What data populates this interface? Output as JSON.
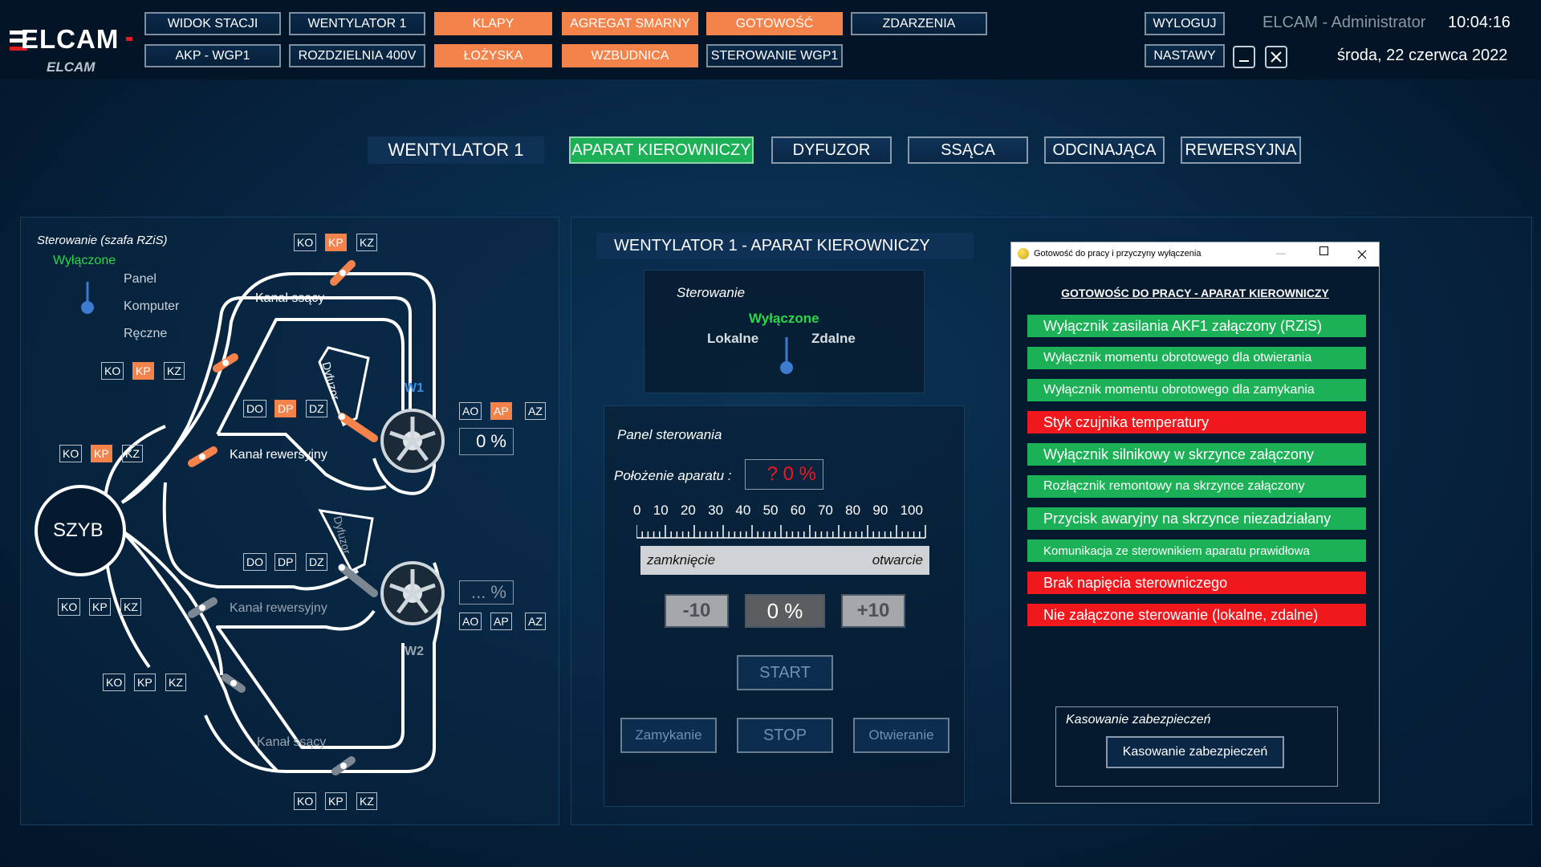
{
  "header": {
    "logo_text": "ELCAM",
    "logo_subtext": "ELCAM",
    "user": "ELCAM - Administrator",
    "time": "10:04:16",
    "date": "środa, 22 czerwca 2022",
    "logout": "WYLOGUJ",
    "settings": "NASTAWY",
    "nav_row1": [
      "WIDOK STACJI",
      "WENTYLATOR 1",
      "KLAPY",
      "AGREGAT SMARNY",
      "GOTOWOŚĆ",
      "ZDARZENIA"
    ],
    "nav_row2": [
      "AKP - WGP1",
      "ROZDZIELNIA 400V",
      "ŁOŻYSKA",
      "WZBUDNICA",
      "STEROWANIE WGP1"
    ]
  },
  "tabs": {
    "title": "WENTYLATOR 1",
    "items": [
      "APARAT KIEROWNICZY",
      "DYFUZOR",
      "SSĄCA",
      "ODCINAJĄCA",
      "REWERSYJNA"
    ],
    "active": "APARAT KIEROWNICZY"
  },
  "schema": {
    "control_title": "Sterowanie (szafa RZiS)",
    "control_state": "Wyłączone",
    "switch_positions": [
      "Panel",
      "Komputer",
      "Ręczne"
    ],
    "shaft": "SZYB",
    "inlet1": "Kanał ssący",
    "reverse1": "Kanał rewersyjny",
    "reverse2": "Kanał rewersyjny",
    "inlet2": "Kanał ssący",
    "diffuser1": "Dyfuzor",
    "diffuser2": "Dyfuzor",
    "fan1": "W1",
    "fan2": "W2",
    "fan1_value": "0 %",
    "fan2_value": "... %",
    "ko": "KO",
    "kp": "KP",
    "kz": "KZ",
    "do": "DO",
    "dp": "DP",
    "dz": "DZ",
    "ao": "AO",
    "ap": "AP",
    "az": "AZ"
  },
  "center": {
    "title": "WENTYLATOR 1 - APARAT KIEROWNICZY",
    "control_label": "Sterowanie",
    "control_state": "Wyłączone",
    "local": "Lokalne",
    "remote": "Zdalne",
    "panel_title": "Panel sterowania",
    "position_label": "Położenie aparatu :",
    "position_value": "? 0 %",
    "scale": [
      "0",
      "10",
      "20",
      "30",
      "40",
      "50",
      "60",
      "70",
      "80",
      "90",
      "100"
    ],
    "closing": "zamknięcie",
    "opening": "otwarcie",
    "minus": "-10",
    "setpoint": "0 %",
    "plus": "+10",
    "start": "START",
    "close_btn": "Zamykanie",
    "stop": "STOP",
    "open_btn": "Otwieranie"
  },
  "dialog": {
    "window_title": "Gotowość do pracy i przyczyny wyłączenia",
    "heading": "GOTOWOŚC DO PRACY - APARAT KIEROWNICZY",
    "items": [
      {
        "text": "Wyłącznik zasilania AKF1 załączony (RZiS)",
        "status": "ok"
      },
      {
        "text": "Wyłącznik momentu obrotowego dla otwierania",
        "status": "ok"
      },
      {
        "text": "Wyłącznik momentu obrotowego dla zamykania",
        "status": "ok"
      },
      {
        "text": "Styk czujnika temperatury",
        "status": "bad"
      },
      {
        "text": "Wyłącznik silnikowy w skrzynce załączony",
        "status": "ok"
      },
      {
        "text": "Rozłącznik remontowy na skrzynce załączony",
        "status": "ok"
      },
      {
        "text": "Przycisk awaryjny na skrzynce niezadziałany",
        "status": "ok"
      },
      {
        "text": "Komunikacja ze sterownikiem aparatu prawidłowa",
        "status": "ok"
      },
      {
        "text": "Brak napięcia sterowniczego",
        "status": "bad"
      },
      {
        "text": "Nie załączone sterowanie (lokalne, zdalne)",
        "status": "bad"
      }
    ],
    "reset_title": "Kasowanie zabezpieczeń",
    "reset_button": "Kasowanie zabezpieczeń"
  },
  "colors": {
    "ok": "#1db157",
    "bad": "#f0181d",
    "accent": "#f3834a",
    "state_green": "#2bd84a"
  }
}
